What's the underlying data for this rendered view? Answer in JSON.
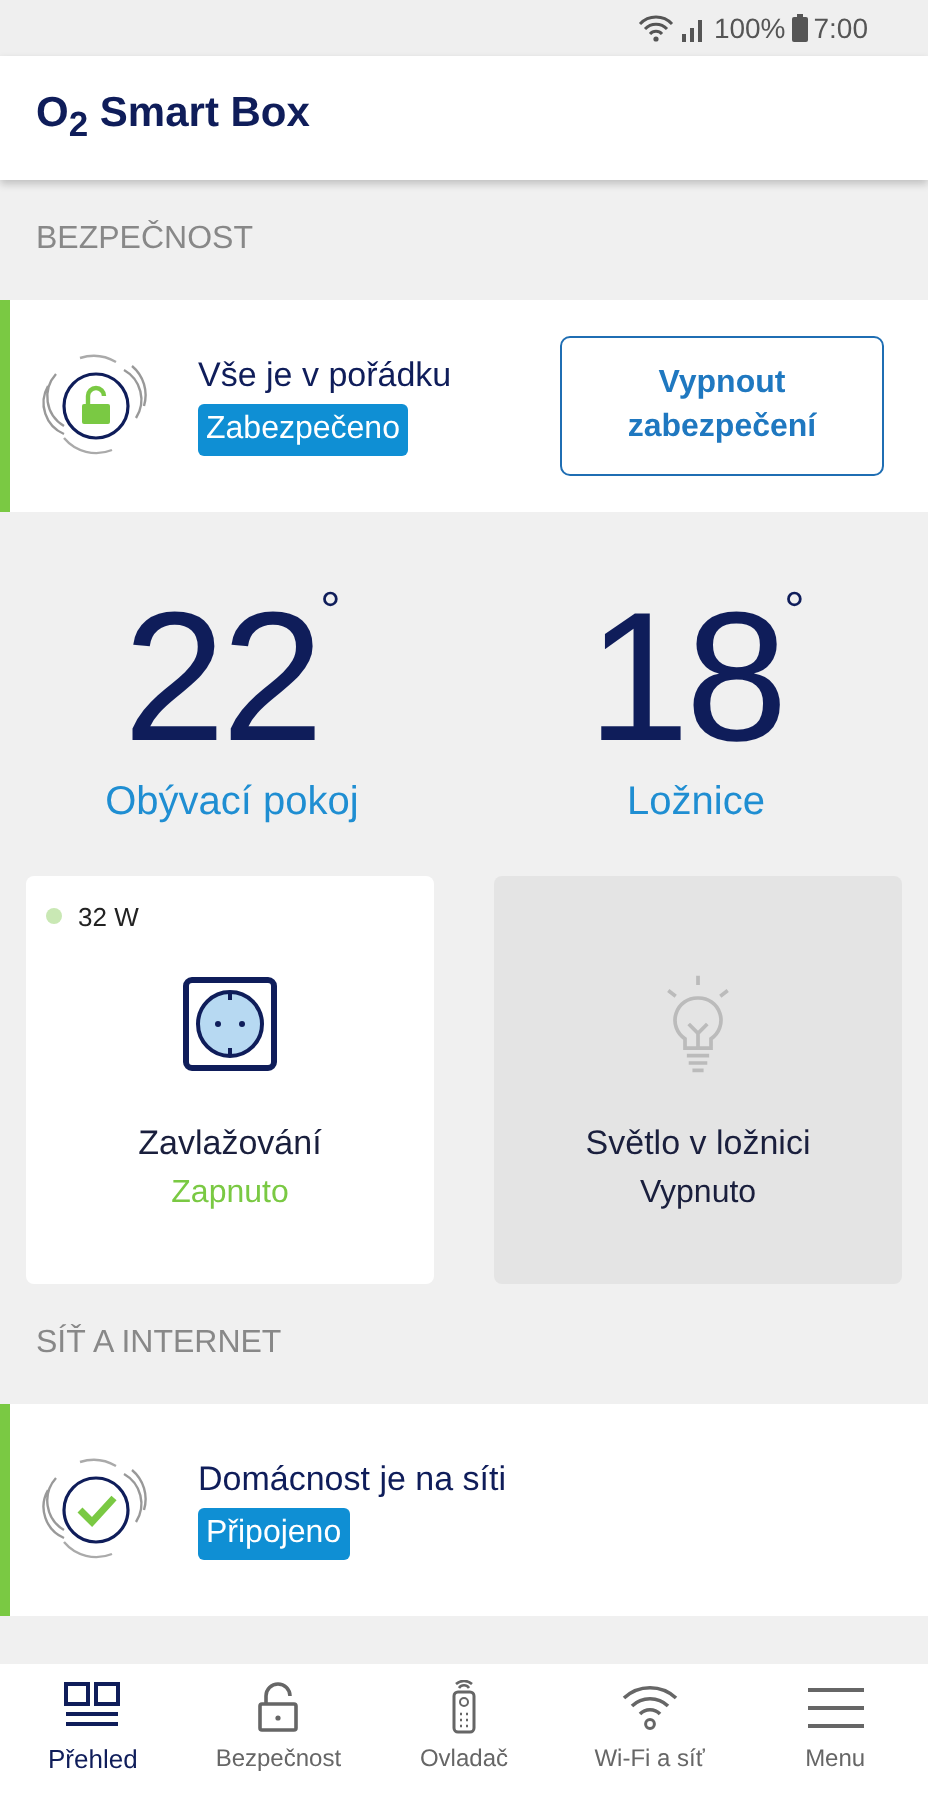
{
  "status_bar": {
    "battery": "100%",
    "time": "7:00"
  },
  "app_bar": {
    "title": "O$_{2}$ Smart Box"
  },
  "security": {
    "heading": "BEZPEČNOST",
    "card": {
      "kind": "lock",
      "title": "Vše je v pořádku",
      "badge": "Zabezpečeno",
      "button": "Vypnout zabezpečení"
    }
  },
  "temperatures": [
    {
      "value": "22",
      "unit": "°",
      "room": "Obývací pokoj"
    },
    {
      "value": "18",
      "unit": "°",
      "room": "Ložnice"
    }
  ],
  "devices": [
    {
      "kind": "socket",
      "power": "32 W",
      "name": "Zavlažování",
      "state": "Zapnuto",
      "on": true
    },
    {
      "kind": "bulb",
      "name": "Světlo v ložnici",
      "state": "Vypnuto",
      "on": false
    }
  ],
  "network": {
    "heading": "SÍŤ A INTERNET",
    "card": {
      "kind": "check",
      "title": "Domácnost je na síti",
      "badge": "Připojeno"
    }
  },
  "nav": [
    {
      "kind": "overview",
      "label": "Přehled",
      "selected": true
    },
    {
      "kind": "lock",
      "label": "Bezpečnost",
      "selected": false
    },
    {
      "kind": "remote",
      "label": "Ovladač",
      "selected": false
    },
    {
      "kind": "wifi",
      "label": "Wi-Fi a síť",
      "selected": false
    },
    {
      "kind": "menu",
      "label": "Menu",
      "selected": false
    }
  ]
}
